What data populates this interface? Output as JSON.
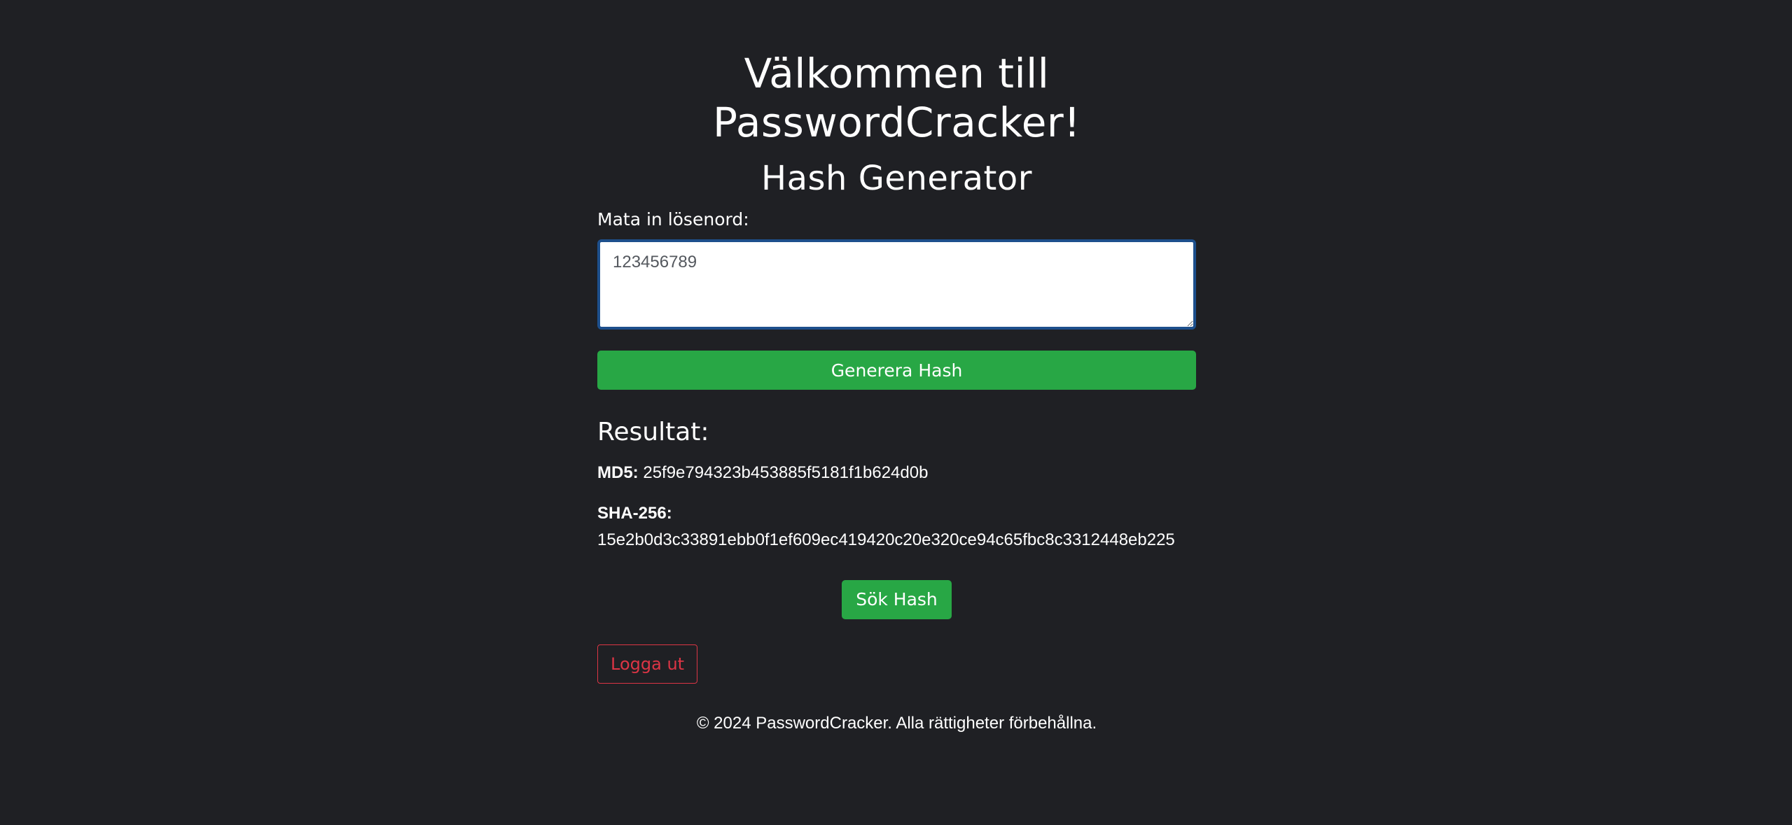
{
  "header": {
    "title_line1": "Välkommen till",
    "title_line2": "PasswordCracker!",
    "subtitle": "Hash Generator"
  },
  "form": {
    "label": "Mata in lösenord:",
    "input_value": "123456789",
    "generate_button": "Generera Hash"
  },
  "result": {
    "heading": "Resultat:",
    "md5_label": "MD5:",
    "md5_value": "25f9e794323b453885f5181f1b624d0b",
    "sha256_label": "SHA-256:",
    "sha256_value": "15e2b0d3c33891ebb0f1ef609ec419420c20e320ce94c65fbc8c3312448eb225"
  },
  "actions": {
    "search_button": "Sök Hash",
    "logout_button": "Logga ut"
  },
  "footer": {
    "text": "© 2024 PasswordCracker. Alla rättigheter förbehållna."
  },
  "colors": {
    "background": "#1f2024",
    "success": "#28a745",
    "danger": "#dc3545",
    "focus_border": "#1d4f8c"
  }
}
